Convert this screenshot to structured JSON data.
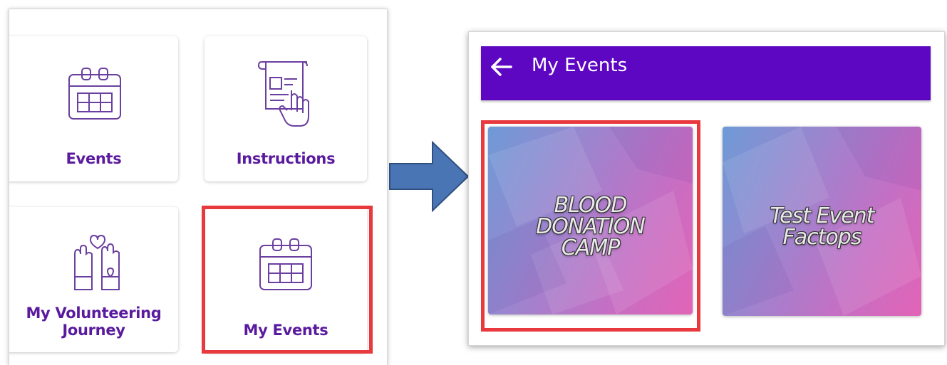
{
  "left_screen": {
    "tiles": [
      {
        "label": "Events",
        "icon": "calendar-icon"
      },
      {
        "label": "Instructions",
        "icon": "document-tap-icon"
      },
      {
        "label_line1": "My Volunteering",
        "label_line2": "Journey",
        "icon": "volunteer-hands-icon"
      },
      {
        "label": "My Events",
        "icon": "calendar-icon"
      }
    ]
  },
  "right_screen": {
    "header": {
      "title": "My Events",
      "back_icon": "arrow-left-icon"
    },
    "events": [
      {
        "title_lines": [
          "BLOOD",
          "DONATION",
          "CAMP"
        ]
      },
      {
        "title_lines": [
          "Test Event",
          "Factops"
        ]
      }
    ]
  },
  "colors": {
    "header_bg": "#5d07c2",
    "tile_label": "#5a1a9e",
    "icon_stroke": "#6b3fa0",
    "highlight": "#e8393e",
    "arrow_fill": "#4a75b5",
    "arrow_stroke": "#2f4f7f"
  }
}
